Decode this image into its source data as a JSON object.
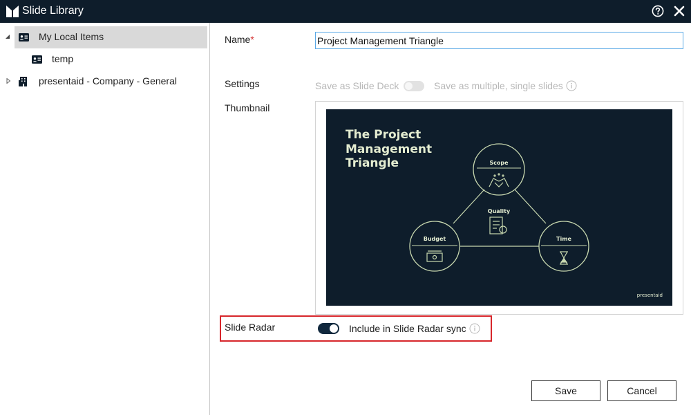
{
  "window": {
    "title": "Slide Library",
    "logo_icon": "presentaid-logo-icon",
    "help_icon": "help-icon",
    "close_icon": "close-icon"
  },
  "tree": {
    "items": [
      {
        "label": "My Local Items",
        "icon": "contact-card-icon",
        "expanded": true,
        "selected": true
      },
      {
        "label": "temp",
        "icon": "contact-card-icon",
        "child": true
      },
      {
        "label": "presentaid - Company - General",
        "icon": "building-icon",
        "expanded": false
      }
    ]
  },
  "form": {
    "name_label": "Name",
    "name_required_mark": "*",
    "name_value": "Project Management Triangle",
    "settings_label": "Settings",
    "save_as_deck_label": "Save as Slide Deck",
    "save_as_multiple_label": "Save as multiple, single slides",
    "save_as_deck_enabled": false,
    "thumbnail_label": "Thumbnail",
    "slide_radar_label": "Slide Radar",
    "slide_radar_sync_label": "Include in Slide Radar sync",
    "slide_radar_sync_on": true
  },
  "thumbnail": {
    "title_line1": "The Project",
    "title_line2": "Management",
    "title_line3": "Triangle",
    "node_scope": "Scope",
    "node_quality": "Quality",
    "node_budget": "Budget",
    "node_time": "Time",
    "brand": "presentaid",
    "background": "#0e1d2b",
    "accent": "#c9d9b0"
  },
  "buttons": {
    "save_label": "Save",
    "cancel_label": "Cancel"
  },
  "colors": {
    "titlebar": "#0e1d2b",
    "highlight_border": "#d7262b",
    "input_focus_border": "#5aa9e6",
    "required": "#d32f2f"
  }
}
